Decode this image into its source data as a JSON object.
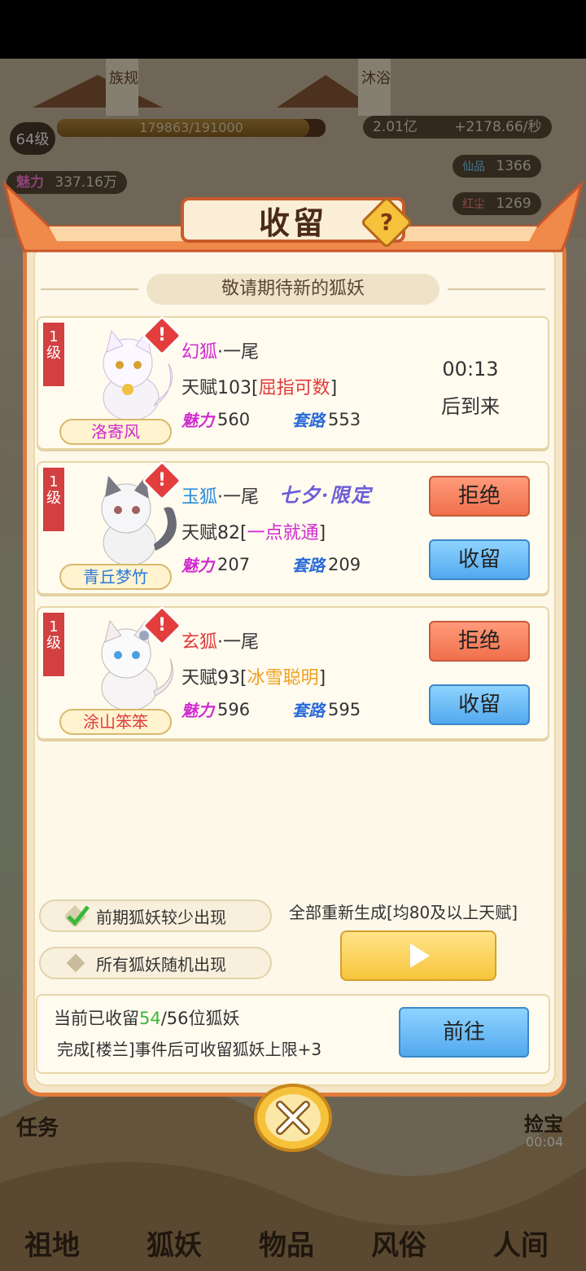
{
  "hud": {
    "level": "64级",
    "exp_text": "179863/191000",
    "exp_fraction": 0.94,
    "currency": "2.01亿",
    "rate": "+2178.66/秒",
    "charm_label": "魅力",
    "charm_value": "337.16万",
    "stat1_label": "仙品",
    "stat1_value": "1366",
    "stat2_label": "红尘",
    "stat2_value": "1269",
    "bg_sign1": "族规",
    "bg_sign2": "沐浴",
    "bg_timer": "00:04",
    "task_label": "任务",
    "treasure_label": "捡宝"
  },
  "nav": {
    "items": [
      "祖地",
      "狐妖",
      "物品",
      "风俗",
      "人间"
    ]
  },
  "dialog": {
    "title": "收留",
    "help": "?",
    "subtitle": "敬请期待新的狐妖",
    "warn_mark": "!",
    "charm_tag": "魅力",
    "route_tag": "套路",
    "reject_label": "拒绝",
    "accept_label": "收留",
    "cards": [
      {
        "level": "1级",
        "name": "洛寄风",
        "species": "幻狐",
        "species_color": "#d02ad0",
        "tail": "·一尾",
        "talent_prefix": "天赋103[",
        "talent_name": "屈指可数",
        "talent_color": "#e03a3a",
        "talent_suffix": "]",
        "charm": "560",
        "route": "553",
        "timer": "00:13",
        "timer_suffix": "后到来"
      },
      {
        "level": "1级",
        "name": "青丘梦竹",
        "species": "玉狐",
        "species_color": "#2a8ad8",
        "tail": "·一尾",
        "limited": "七夕·限定",
        "talent_prefix": "天赋82[",
        "talent_name": "一点就通",
        "talent_color": "#d02ad0",
        "talent_suffix": "]",
        "charm": "207",
        "route": "209"
      },
      {
        "level": "1级",
        "name": "涂山笨笨",
        "species": "玄狐",
        "species_color": "#e03a3a",
        "tail": "·一尾",
        "talent_prefix": "天赋93[",
        "talent_name": "冰雪聪明",
        "talent_color": "#f0a020",
        "talent_suffix": "]",
        "charm": "596",
        "route": "595"
      }
    ],
    "toggle_fewer": "前期狐妖较少出现",
    "toggle_random": "所有狐妖随机出现",
    "regen_label": "全部重新生成[均80及以上天赋]",
    "footer": {
      "prefix": "当前已收留",
      "current": "54",
      "rest": "/56位狐妖",
      "note": "完成[楼兰]事件后可收留狐妖上限+3",
      "goto_label": "前往"
    }
  },
  "colors": {
    "frame": "#e27b3c",
    "accent_green": "#3ab83a",
    "reject": "#f0704c",
    "accept": "#52a9ee"
  }
}
